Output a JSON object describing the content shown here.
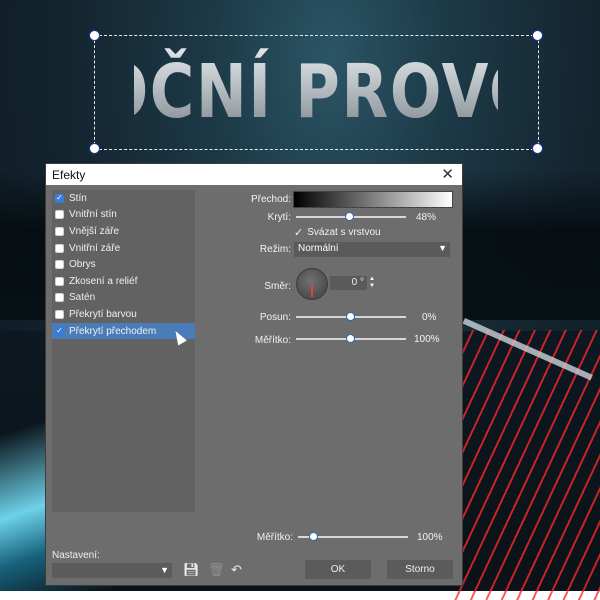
{
  "canvas": {
    "headline": "NOČNÍ PROVOZ"
  },
  "dialog": {
    "title": "Efekty",
    "close_glyph": "✕",
    "effects": [
      {
        "label": "Stín",
        "checked": true
      },
      {
        "label": "Vnitřní stín",
        "checked": false
      },
      {
        "label": "Vnější záře",
        "checked": false
      },
      {
        "label": "Vnitřní záře",
        "checked": false
      },
      {
        "label": "Obrys",
        "checked": false
      },
      {
        "label": "Zkosení a reliéf",
        "checked": false
      },
      {
        "label": "Satén",
        "checked": false
      },
      {
        "label": "Překrytí barvou",
        "checked": false
      },
      {
        "label": "Překrytí přechodem",
        "checked": true,
        "selected": true
      }
    ],
    "settings": {
      "gradient_label": "Přechod:",
      "opacity_label": "Krytí:",
      "opacity_value": "48%",
      "opacity_fraction": 0.48,
      "link_layer_label": "Svázat s vrstvou",
      "link_layer_checked": true,
      "mode_label": "Režim:",
      "mode_value": "Normální",
      "direction_label": "Směr:",
      "direction_value": "0 °",
      "offset_label": "Posun:",
      "offset_value": "0%",
      "scale_label": "Měřítko:",
      "scale_value": "100%",
      "global_scale_label": "Měřítko:",
      "global_scale_value": "100%"
    },
    "presets_label": "Nastavení:",
    "ok_label": "OK",
    "cancel_label": "Storno"
  },
  "colors": {
    "accent": "#3a7cd6",
    "selection_bg": "#4a7db8"
  }
}
